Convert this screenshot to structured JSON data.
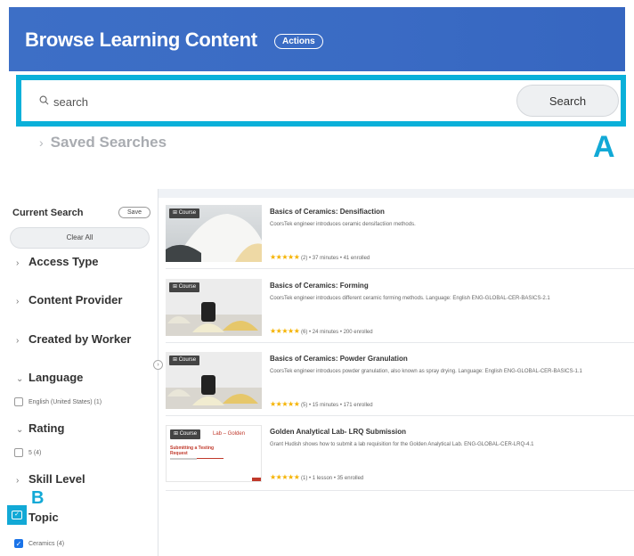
{
  "header": {
    "title": "Browse Learning Content",
    "actions_label": "Actions"
  },
  "search": {
    "placeholder": "search",
    "button_label": "Search",
    "annotation": "A"
  },
  "saved_searches_label": "Saved Searches",
  "sidebar": {
    "current_search_label": "Current Search",
    "save_label": "Save",
    "clear_all_label": "Clear All",
    "facets": {
      "access_type": "Access Type",
      "content_provider": "Content Provider",
      "created_by_worker": "Created by Worker",
      "language": "Language",
      "rating": "Rating",
      "skill_level": "Skill Level",
      "topic": "Topic"
    },
    "options": {
      "language_english": "English (United States)  (1)",
      "rating_5": "5  (4)",
      "topic_ceramics": "Ceramics  (4)"
    },
    "annotation": "B"
  },
  "results": [
    {
      "tag": "Course",
      "title": "Basics of Ceramics: Densifiaction",
      "description": "CoorsTek engineer introduces ceramic densifactiion methods.",
      "stars": "★★★★★",
      "meta": "(2)  •  37 minutes  •  41 enrolled"
    },
    {
      "tag": "Course",
      "title": "Basics of Ceramics: Forming",
      "description": "CoorsTek engineer introduces different ceramic forming methods. Language: English ENG-GLOBAL-CER-BASICS-2.1",
      "stars": "★★★★★",
      "meta": "(6)  •  24 minutes  •  200 enrolled"
    },
    {
      "tag": "Course",
      "title": "Basics of Ceramics: Powder Granulation",
      "description": "CoorsTek engineer introduces powder granulation, also known as spray drying. Language: English ENG-GLOBAL-CER-BASICS-1.1",
      "stars": "★★★★★",
      "meta": "(5)  •  15 minutes  •  171 enrolled"
    },
    {
      "tag": "Course",
      "title": "Golden Analytical Lab- LRQ Submission",
      "description": "Grant Hudish shows how to submit a lab requisition for the Golden Analytical Lab. ENG-GLOBAL-CER-LRQ-4.1",
      "stars": "★★★★★",
      "meta": "(1)  •  1 lesson  •  35 enrolled",
      "thumb_heading": "Lab – Golden",
      "thumb_subheading": "Submitting a Testing Request"
    }
  ],
  "colors": {
    "header_blue": "#3a6bc4",
    "annotation_cyan": "#12a9d6",
    "star_gold": "#f5b301"
  }
}
